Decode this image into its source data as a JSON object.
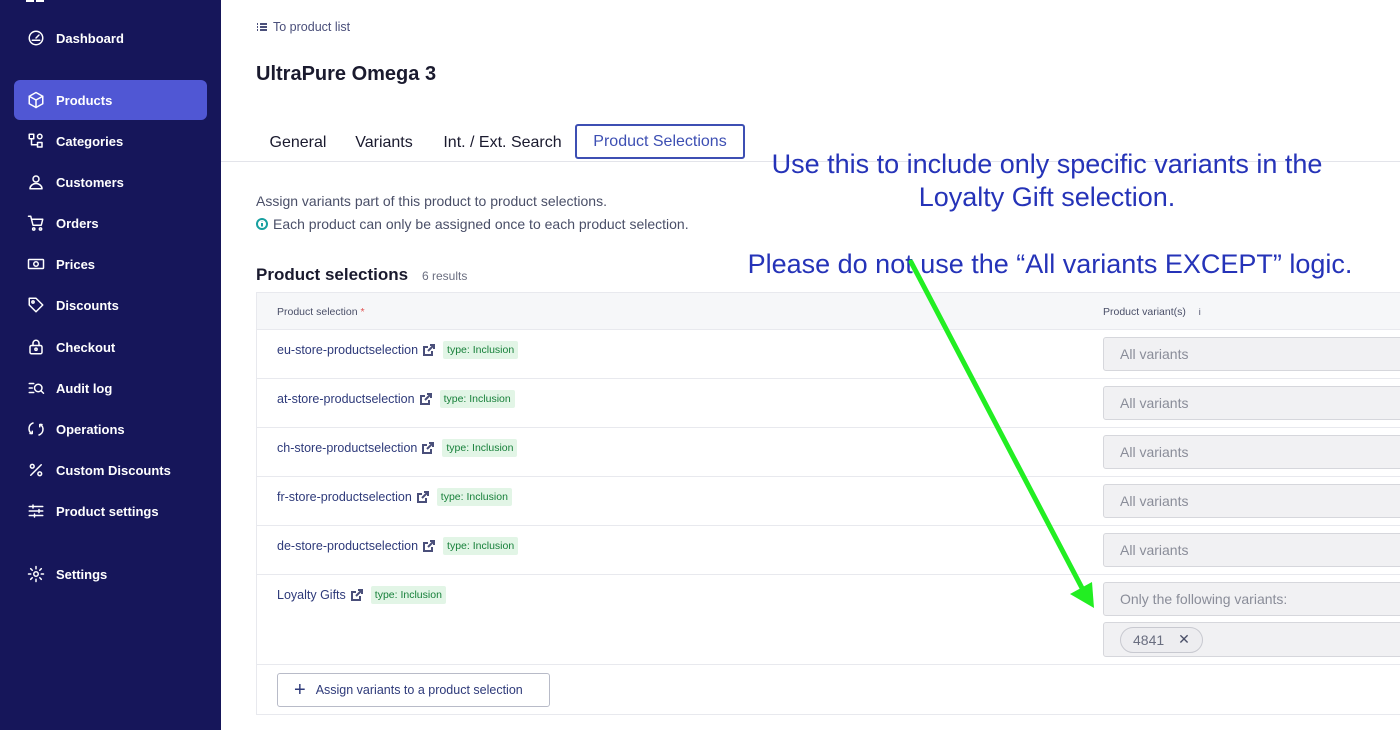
{
  "sidebar": {
    "items": [
      {
        "label": "Dashboard",
        "icon": "gauge-icon",
        "active": false
      },
      {
        "label": "Products",
        "icon": "box-icon",
        "active": true
      },
      {
        "label": "Categories",
        "icon": "categories-icon",
        "active": false
      },
      {
        "label": "Customers",
        "icon": "user-icon",
        "active": false
      },
      {
        "label": "Orders",
        "icon": "cart-icon",
        "active": false
      },
      {
        "label": "Prices",
        "icon": "money-icon",
        "active": false
      },
      {
        "label": "Discounts",
        "icon": "tag-icon",
        "active": false
      },
      {
        "label": "Checkout",
        "icon": "lock-bag-icon",
        "active": false
      },
      {
        "label": "Audit log",
        "icon": "audit-log-icon",
        "active": false
      },
      {
        "label": "Operations",
        "icon": "operations-icon",
        "active": false
      },
      {
        "label": "Custom Discounts",
        "icon": "percent-icon",
        "active": false
      },
      {
        "label": "Product settings",
        "icon": "sliders-icon",
        "active": false
      },
      {
        "label": "Settings",
        "icon": "gear-icon",
        "active": false
      }
    ]
  },
  "header": {
    "back_link": "To product list",
    "title": "UltraPure Omega 3"
  },
  "tabs": [
    {
      "label": "General",
      "active": false
    },
    {
      "label": "Variants",
      "active": false
    },
    {
      "label": "Int. / Ext. Search",
      "active": false
    },
    {
      "label": "Product Selections",
      "active": true
    }
  ],
  "content": {
    "description": "Assign variants part of this product to product selections.",
    "info_note": "Each product can only be assigned once to each product selection.",
    "section_title": "Product selections",
    "result_count": "6 results"
  },
  "table": {
    "columns": {
      "selection": "Product selection",
      "required_mark": "*",
      "variants": "Product variant(s)",
      "info_mark": "i"
    },
    "rows": [
      {
        "name": "eu-store-productselection",
        "type": "type: Inclusion",
        "variants": "All variants"
      },
      {
        "name": "at-store-productselection",
        "type": "type: Inclusion",
        "variants": "All variants"
      },
      {
        "name": "ch-store-productselection",
        "type": "type: Inclusion",
        "variants": "All variants"
      },
      {
        "name": "fr-store-productselection",
        "type": "type: Inclusion",
        "variants": "All variants"
      },
      {
        "name": "de-store-productselection",
        "type": "type: Inclusion",
        "variants": "All variants"
      },
      {
        "name": "Loyalty Gifts",
        "type": "type: Inclusion",
        "variants": "Only the following variants:",
        "chip": "4841",
        "chip_remove": "✕"
      }
    ],
    "assign_button": "Assign variants to a product selection",
    "assign_plus": "+"
  },
  "annotation": {
    "line1": "Use this to include only specific variants in the",
    "line2": "Loyalty Gift selection.",
    "line3": "Please do not use the “All variants EXCEPT” logic.",
    "color": "#2533b8",
    "arrow_color": "#22ee22"
  }
}
